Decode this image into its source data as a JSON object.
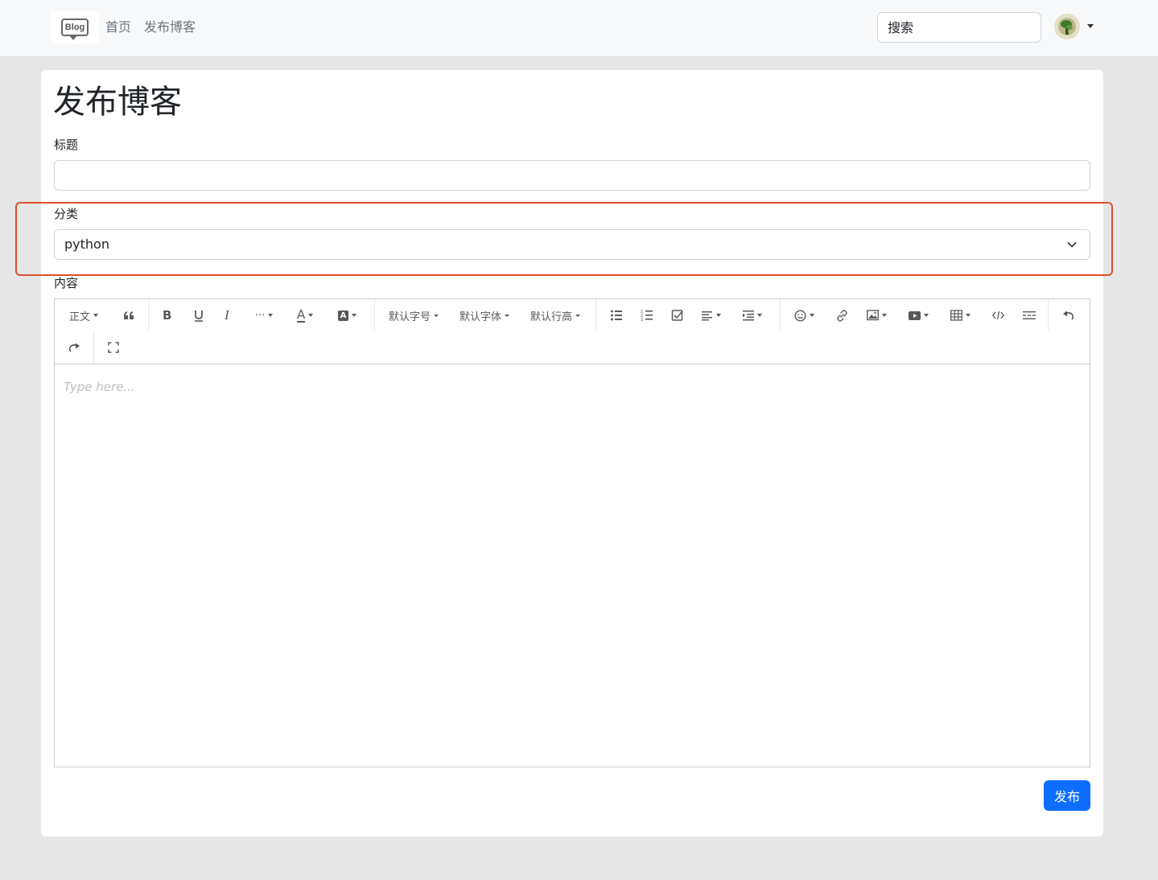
{
  "nav": {
    "logo_text": "Blog",
    "home": "首页",
    "publish": "发布博客",
    "search_placeholder": "搜索"
  },
  "form": {
    "heading": "发布博客",
    "title_label": "标题",
    "title_value": "",
    "category_label": "分类",
    "category_selected": "python",
    "content_label": "内容",
    "content_placeholder": "Type here...",
    "submit_label": "发布"
  },
  "toolbar": {
    "heading_dropdown": "正文",
    "font_size": "默认字号",
    "font_family": "默认字体",
    "line_height": "默认行高",
    "more": "···",
    "font_color": "A",
    "bg_color": "A",
    "icons": [
      "quote-icon",
      "bold-icon",
      "underline-icon",
      "italic-icon",
      "more-icon",
      "font-color-icon",
      "bg-color-icon",
      "bullet-list-icon",
      "numbered-list-icon",
      "todo-icon",
      "align-icon",
      "indent-icon",
      "emoji-icon",
      "link-icon",
      "image-icon",
      "video-icon",
      "table-icon",
      "code-icon",
      "divider-icon",
      "undo-icon",
      "redo-icon",
      "fullscreen-icon"
    ]
  },
  "colors": {
    "accent": "#0d6efd",
    "highlight": "#d9502f",
    "navbar_bg": "#f8f9fa",
    "page_bg": "#e6e6e6"
  }
}
